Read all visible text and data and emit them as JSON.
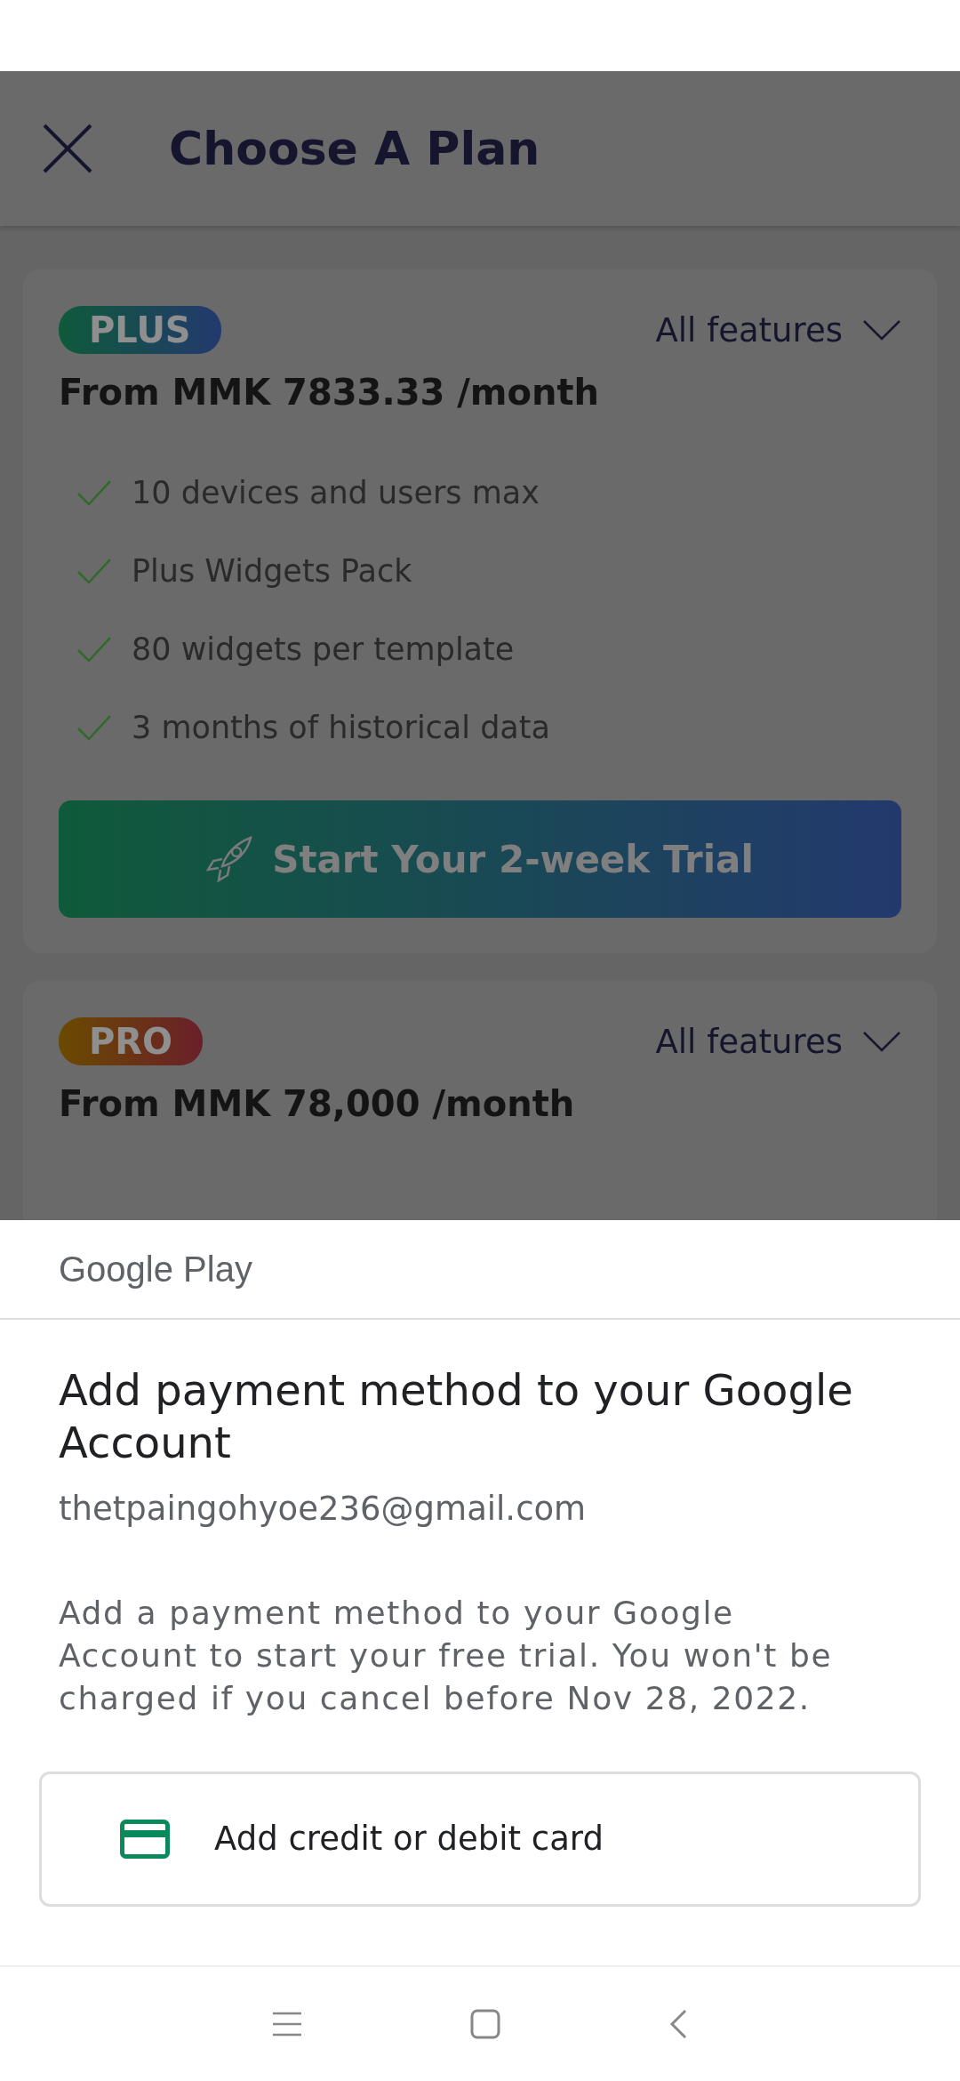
{
  "header": {
    "title": "Choose A Plan"
  },
  "plans": [
    {
      "kind": "plus",
      "badge": "PLUS",
      "features_toggle": "All features",
      "price": "From MMK 7833.33 /month",
      "features": [
        "10 devices and users max",
        "Plus Widgets Pack",
        "80 widgets per template",
        "3 months of historical data"
      ],
      "button": "Start Your 2-week Trial"
    },
    {
      "kind": "pro",
      "badge": "PRO",
      "features_toggle": "All features",
      "price": "From MMK 78,000 /month"
    }
  ],
  "sheet": {
    "brand": "Google Play",
    "title": "Add payment method to your Google Account",
    "email": "thetpaingohyoe236@gmail.com",
    "body": "Add a payment method to your Google Account to start your free trial. You won't be charged if you cancel before Nov 28, 2022.",
    "option": "Add credit or debit card"
  }
}
